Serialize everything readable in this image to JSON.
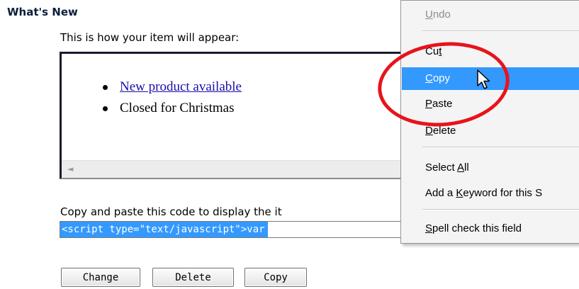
{
  "section": {
    "title": "What's New",
    "intro": "This is how your item will appear:"
  },
  "preview": {
    "items": [
      {
        "text": "New product available",
        "link": true
      },
      {
        "text": "Closed for Christmas",
        "link": false
      }
    ],
    "scroll_arrow": "◄"
  },
  "code": {
    "label": "Copy and paste this code to display the it",
    "selected_text": "<script type=\"text/javascript\">var "
  },
  "buttons": {
    "change": "Change",
    "delete": "Delete",
    "copy": "Copy"
  },
  "context_menu": {
    "undo": {
      "pre": "",
      "key": "U",
      "post": "ndo"
    },
    "cut": {
      "pre": "Cu",
      "key": "t",
      "post": ""
    },
    "copy": {
      "pre": "",
      "key": "C",
      "post": "opy"
    },
    "paste": {
      "pre": "",
      "key": "P",
      "post": "aste"
    },
    "delete": {
      "pre": "",
      "key": "D",
      "post": "elete"
    },
    "select_all": {
      "pre": "Select ",
      "key": "A",
      "post": "ll"
    },
    "add_keyword": {
      "pre": "Add a ",
      "key": "K",
      "post": "eyword for this S"
    },
    "spell_check": {
      "pre": "",
      "key": "S",
      "post": "pell check this field"
    }
  },
  "colors": {
    "highlight": "#3399ff",
    "annotation": "#e8131b",
    "link": "#1a0dab"
  },
  "icons": {
    "cursor": "mouse-pointer-icon",
    "scroll": "scroll-left-arrow-icon"
  }
}
